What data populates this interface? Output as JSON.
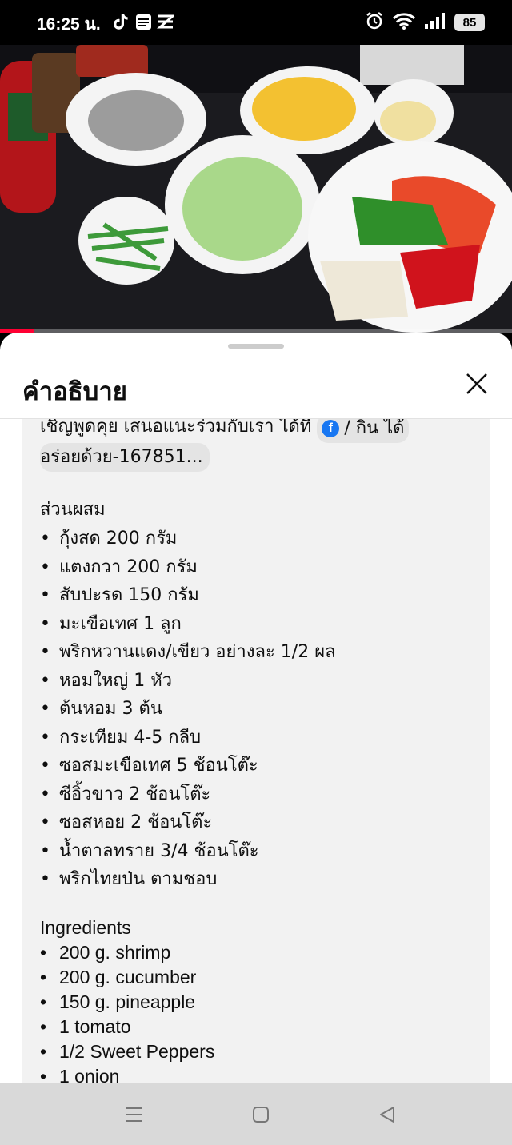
{
  "status_bar": {
    "time": "16:25 น.",
    "battery": "85",
    "icons": [
      "tiktok-icon",
      "app-icon",
      "app-icon-2",
      "alarm-icon",
      "wifi-icon",
      "signal-icon",
      "battery-icon"
    ]
  },
  "video": {
    "progress_fraction": 0.065
  },
  "sheet": {
    "title": "คำอธิบาย",
    "intro_text": "เชิญพูดคุย เสนอแนะร่วมกับเรา ได้ที่",
    "link_text": "/ กิน ได้",
    "link_text_2": "อร่อยด้วย-167851...",
    "thai_section_title": "ส่วนผสม",
    "thai_ingredients": [
      "กุ้งสด 200 กรัม",
      "แตงกวา 200 กรัม",
      "สับปะรด 150 กรัม",
      "มะเขือเทศ 1 ลูก",
      "พริกหวานแดง/เขียว อย่างละ 1/2 ผล",
      "หอมใหญ่ 1 หัว",
      "ต้นหอม 3 ต้น",
      "กระเทียม 4-5 กลีบ",
      "ซอสมะเขือเทศ 5 ช้อนโต๊ะ",
      "ซีอิ้วขาว 2 ช้อนโต๊ะ",
      "ซอสหอย 2 ช้อนโต๊ะ",
      "น้ำตาลทราย 3/4 ช้อนโต๊ะ",
      "พริกไทยป่น ตามชอบ"
    ],
    "english_section_title": "Ingredients",
    "english_ingredients": [
      "200 g. shrimp",
      "200 g. cucumber",
      "150 g. pineapple",
      "1 tomato",
      "1/2 Sweet Peppers",
      "1 onion"
    ]
  },
  "colors": {
    "accent_red": "#ff0033",
    "facebook_blue": "#1877f2"
  }
}
